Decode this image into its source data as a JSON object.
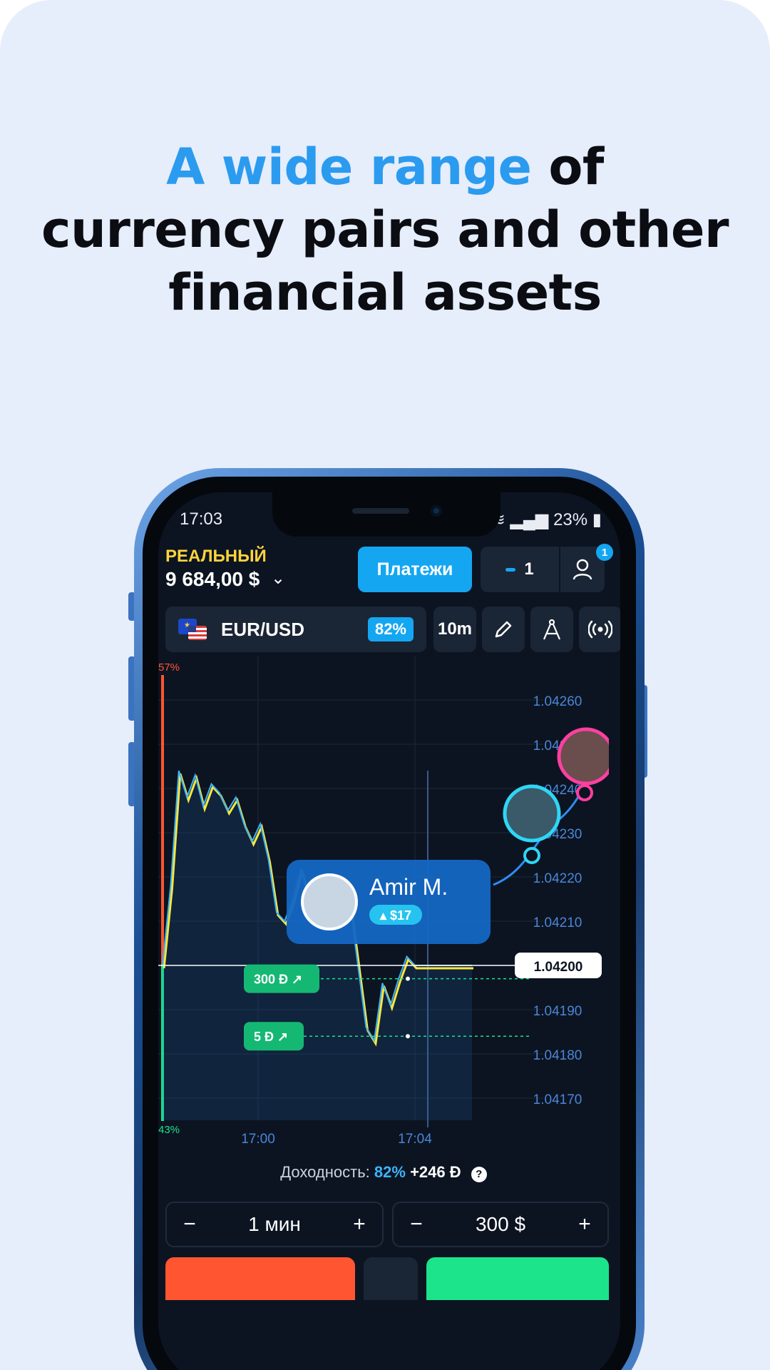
{
  "headline": {
    "accent": "A wide range",
    "rest_line1": " of",
    "line2": "currency pairs and other",
    "line3": "financial assets"
  },
  "status_bar": {
    "time": "17:03",
    "battery": "23%"
  },
  "account": {
    "label": "РЕАЛЬНЫЙ",
    "balance": "9 684,00 $",
    "chevron_icon": "chevron-down-icon"
  },
  "header": {
    "payments_label": "Платежи",
    "open_trades_count": "1",
    "notification_badge": "1"
  },
  "asset_bar": {
    "pair": "EUR/USD",
    "payout": "82%",
    "timeframe": "10m",
    "tools": [
      "pencil-icon",
      "compass-icon",
      "signal-icon"
    ]
  },
  "chart_data": {
    "type": "line",
    "y_ticks": [
      "1.04260",
      "1.04250",
      "1.04240",
      "1.04230",
      "1.04220",
      "1.04210",
      "1.04200",
      "1.04190",
      "1.04180",
      "1.04170"
    ],
    "x_ticks": [
      "17:00",
      "17:04"
    ],
    "ylim": [
      1.04165,
      1.04265
    ],
    "current_price": "1.04200",
    "sentiment_top": "57%",
    "sentiment_bottom": "43%",
    "series": [
      {
        "color": "#3db3f7",
        "x": [
          0,
          1,
          2,
          3,
          4,
          5,
          6,
          7,
          8,
          9,
          10,
          11,
          12,
          13,
          14,
          15,
          16,
          17,
          18,
          19,
          20,
          21,
          22,
          23,
          24,
          25,
          26,
          27,
          28,
          29,
          30,
          31,
          32,
          33,
          34,
          35,
          36,
          37,
          38
        ],
        "y": [
          1.042,
          1.04218,
          1.04244,
          1.04238,
          1.04243,
          1.04236,
          1.04241,
          1.04239,
          1.04235,
          1.04238,
          1.04232,
          1.04228,
          1.04232,
          1.04224,
          1.04212,
          1.0421,
          1.04215,
          1.04222,
          1.04214,
          1.0422,
          1.04213,
          1.04218,
          1.04212,
          1.04214,
          1.042,
          1.04186,
          1.04183,
          1.04196,
          1.04191,
          1.04197,
          1.04202,
          1.042,
          1.042,
          1.042,
          1.042,
          1.042,
          1.042,
          1.042,
          1.042
        ]
      }
    ],
    "trade_markers": [
      {
        "label": "300 Đ",
        "price": 1.04197
      },
      {
        "label": "5 Đ",
        "price": 1.04184
      }
    ]
  },
  "social": {
    "trader_name": "Amir M.",
    "trader_profit": "$17"
  },
  "yield_row": {
    "label": "Доходность:",
    "percent": "82%",
    "gain": "+246 Đ",
    "help": "?"
  },
  "time_stepper": {
    "minus": "−",
    "value": "1 мин",
    "plus": "+"
  },
  "amount_stepper": {
    "minus": "−",
    "value": "300 $",
    "plus": "+"
  },
  "colors": {
    "accent": "#2b9bef",
    "up": "#1be48a",
    "down": "#ff5631",
    "account_label": "#ffd43a"
  }
}
